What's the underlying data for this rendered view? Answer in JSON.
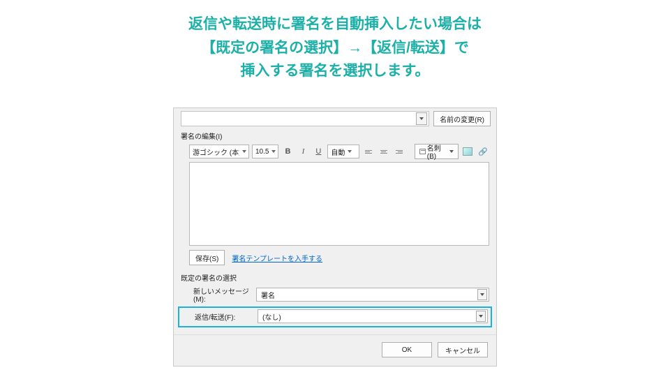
{
  "annotation": {
    "line1": "返信や転送時に署名を自動挿入したい場合は",
    "line2": "【既定の署名の選択】→【返信/転送】で",
    "line3": "挿入する署名を選択します。"
  },
  "dialog": {
    "rename_btn": "名前の変更(R)",
    "edit_label": "署名の編集(I)",
    "font_family": "游ゴシック (本文の",
    "font_size": "10.5",
    "auto_label": "自動",
    "card_btn": "名刺(B)",
    "save_btn": "保存(S)",
    "template_link": "署名テンプレートを入手する",
    "default_section_label": "既定の署名の選択",
    "new_msg_label": "新しいメッセージ(M):",
    "new_msg_value": "署名",
    "reply_fwd_label": "返信/転送(F):",
    "reply_fwd_value": "(なし)",
    "ok": "OK",
    "cancel": "キャンセル"
  }
}
